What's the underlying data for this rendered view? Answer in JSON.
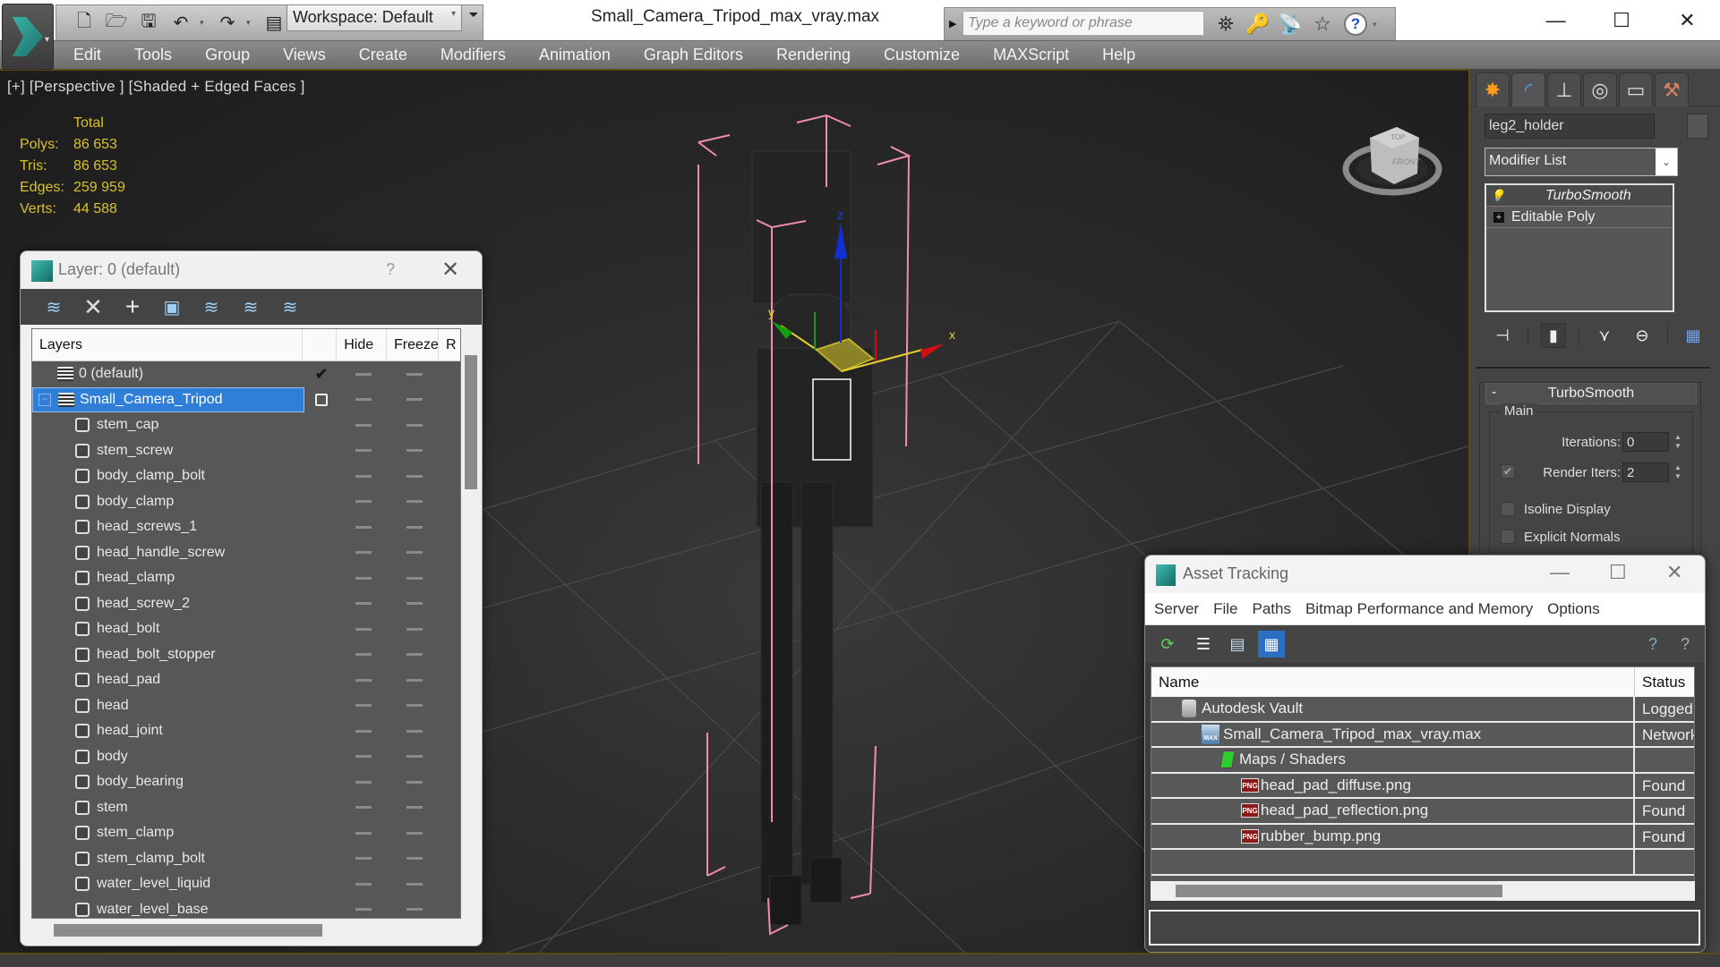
{
  "app": {
    "title": "Small_Camera_Tripod_max_vray.max",
    "workspace": "Workspace: Default",
    "search_placeholder": "Type a keyword or phrase",
    "quick_access_icons": [
      "new-file-icon",
      "open-folder-icon",
      "save-icon",
      "undo-icon",
      "redo-icon",
      "project-folder-icon"
    ],
    "infocenter_icons": [
      "binoculars-icon",
      "key-icon",
      "satellite-icon",
      "star-icon"
    ],
    "window_controls": {
      "minimize": "—",
      "maximize": "☐",
      "close": "✕"
    }
  },
  "menu": [
    "Edit",
    "Tools",
    "Group",
    "Views",
    "Create",
    "Modifiers",
    "Animation",
    "Graph Editors",
    "Rendering",
    "Customize",
    "MAXScript",
    "Help"
  ],
  "viewport": {
    "label": "[+] [Perspective ] [Shaded + Edged Faces ]",
    "stats": {
      "header": "Total",
      "rows": [
        {
          "key": "Polys:",
          "value": "86 653"
        },
        {
          "key": "Tris:",
          "value": "86 653"
        },
        {
          "key": "Edges:",
          "value": "259 959"
        },
        {
          "key": "Verts:",
          "value": "44 588"
        }
      ]
    },
    "gizmo": {
      "x": "x",
      "y": "y",
      "z": "z"
    },
    "viewcube": {
      "top": "TOP",
      "front": "FRONT"
    },
    "colors": {
      "stats": "#d9c12c",
      "selection_bracket": "#f08cb4",
      "x_axis": "#d01010",
      "y_axis": "#10a010",
      "z_axis": "#1030d0"
    }
  },
  "layer_window": {
    "title": "Layer: 0 (default)",
    "help": "?",
    "close": "✕",
    "toolbar_icons": [
      "create-layer-icon",
      "delete-icon",
      "add-to-layer-icon",
      "select-objects-icon",
      "select-layer-icon",
      "highlight-layer-icon",
      "layer-settings-icon"
    ],
    "columns": [
      "Layers",
      "",
      "Hide",
      "Freeze",
      "R"
    ],
    "layers": [
      {
        "name": "0 (default)",
        "type": "layer",
        "current": true
      },
      {
        "name": "Small_Camera_Tripod",
        "type": "layer",
        "selected": true,
        "expanded": true
      }
    ],
    "objects": [
      "stem_cap",
      "stem_screw",
      "body_clamp_bolt",
      "body_clamp",
      "head_screws_1",
      "head_handle_screw",
      "head_clamp",
      "head_screw_2",
      "head_bolt",
      "head_bolt_stopper",
      "head_pad",
      "head",
      "head_joint",
      "body",
      "body_bearing",
      "stem",
      "stem_clamp",
      "stem_clamp_bolt",
      "water_level_liquid",
      "water_level_base"
    ]
  },
  "command_panel": {
    "tabs": [
      "create-icon",
      "modify-icon",
      "hierarchy-icon",
      "motion-icon",
      "display-icon",
      "utilities-icon"
    ],
    "active_tab": 1,
    "object_name": "leg2_holder",
    "modifier_list": "Modifier List",
    "stack": [
      {
        "name": "TurboSmooth",
        "active": true
      },
      {
        "name": "Editable Poly",
        "active": false
      }
    ],
    "rollout": {
      "title": "TurboSmooth",
      "collapse": "-",
      "group": "Main",
      "iterations_label": "Iterations:",
      "iterations": "0",
      "render_iters_label": "Render Iters:",
      "render_iters": "2",
      "render_iters_checked": true,
      "isoline_label": "Isoline Display",
      "isoline_checked": false,
      "explicit_normals_label": "Explicit Normals",
      "explicit_normals_checked": false
    }
  },
  "asset_window": {
    "title": "Asset Tracking",
    "menu": [
      "Server",
      "File",
      "Paths",
      "Bitmap Performance and Memory",
      "Options"
    ],
    "columns": [
      "Name",
      "Status"
    ],
    "rows": [
      {
        "name": "Autodesk Vault",
        "status": "Logged",
        "icon": "vault",
        "indent": 1
      },
      {
        "name": "Small_Camera_Tripod_max_vray.max",
        "status": "Network",
        "icon": "max",
        "indent": 2
      },
      {
        "name": "Maps / Shaders",
        "status": "",
        "icon": "maps",
        "indent": 3
      },
      {
        "name": "head_pad_diffuse.png",
        "status": "Found",
        "icon": "png",
        "indent": 4
      },
      {
        "name": "head_pad_reflection.png",
        "status": "Found",
        "icon": "png",
        "indent": 4
      },
      {
        "name": "rubber_bump.png",
        "status": "Found",
        "icon": "png",
        "indent": 4
      }
    ]
  }
}
